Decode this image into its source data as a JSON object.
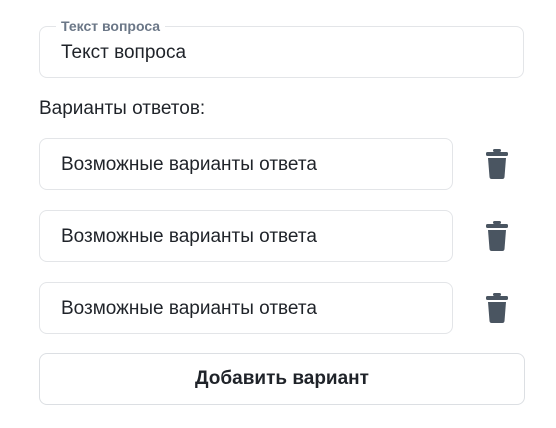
{
  "question": {
    "label": "Текст вопроса",
    "value": "Текст вопроса"
  },
  "answers": {
    "section_label": "Варианты ответов:",
    "options": [
      {
        "value": "Возможные варианты ответа",
        "delete_icon": "trash-icon"
      },
      {
        "value": "Возможные варианты ответа",
        "delete_icon": "trash-icon"
      },
      {
        "value": "Возможные варианты ответа",
        "delete_icon": "trash-icon"
      }
    ]
  },
  "add_button_label": "Добавить вариант",
  "colors": {
    "border": "#e3e5e8",
    "label": "#6b7787",
    "text": "#1f2329",
    "icon": "#4a5561"
  }
}
